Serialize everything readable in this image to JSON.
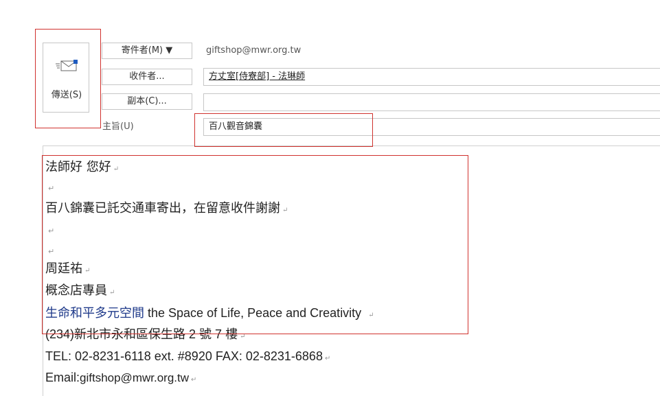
{
  "header": {
    "send_label": "傳送(S)",
    "from_button": "寄件者(M) ▼",
    "from_value": "giftshop@mwr.org.tw",
    "to_button": "收件者...",
    "to_value": "方丈室[侍寮部] - 法琳師",
    "cc_button": "副本(C)...",
    "cc_value": "",
    "subject_label": "主旨(U)",
    "subject_value": "百八觀音錦囊"
  },
  "body": {
    "line1": "法師好 您好",
    "line2": "百八錦囊已託交通車寄出，在留意收件謝謝",
    "sig_name": "周廷祐",
    "sig_title": "概念店專員",
    "sig_org_cn": "生命和平多元空間",
    "sig_org_en": " the Space of Life, Peace and Creativity",
    "sig_addr_pre": "(234)",
    "sig_addr_cn": "新北市永和區保生路",
    "sig_addr_num1": " 2 ",
    "sig_addr_cn2": "號",
    "sig_addr_num2": " 7 ",
    "sig_addr_cn3": "樓",
    "sig_tel": "TEL: 02-8231-6118 ext. #8920 FAX: 02-8231-6868",
    "sig_email_label": "Email:",
    "sig_email": "giftshop@mwr.org.tw",
    "para_mark": "↵"
  },
  "colors": {
    "annotation_red": "#d0312d",
    "org_blue": "#1f3a8a"
  }
}
